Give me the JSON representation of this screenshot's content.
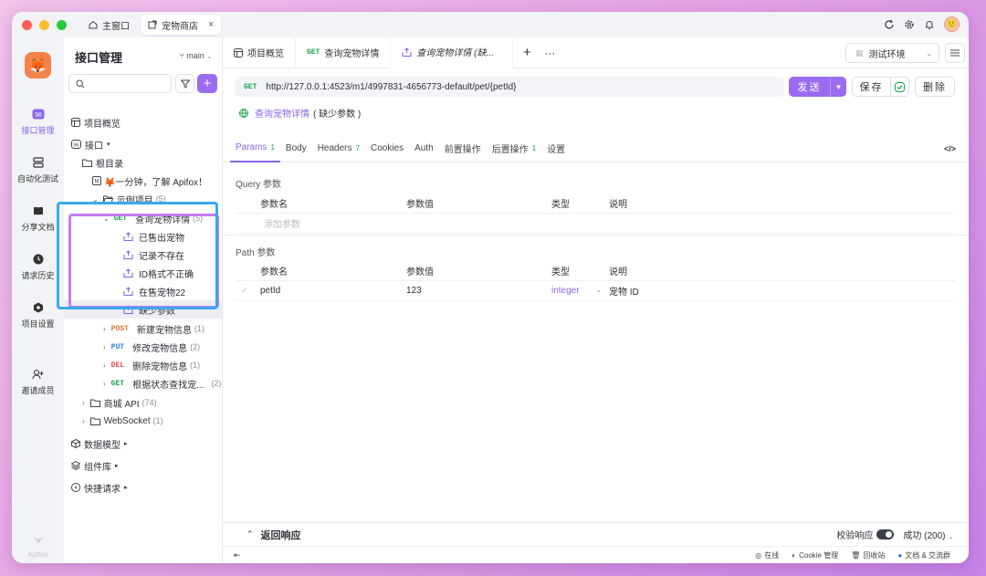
{
  "titlebar": {
    "tabs": [
      {
        "label": "主窗口"
      },
      {
        "label": "宠物商店"
      }
    ]
  },
  "rail": {
    "items": [
      {
        "label": "接口管理",
        "icon": "api-icon"
      },
      {
        "label": "自动化测试",
        "icon": "automation-icon"
      },
      {
        "label": "分享文档",
        "icon": "book-icon"
      },
      {
        "label": "请求历史",
        "icon": "history-icon"
      },
      {
        "label": "项目设置",
        "icon": "settings-icon"
      },
      {
        "label": "邀请成员",
        "icon": "invite-icon"
      }
    ],
    "brand": "Apifox"
  },
  "sidebar": {
    "title": "接口管理",
    "branch": "main",
    "search_placeholder": "",
    "tree": [
      {
        "label": "项目概览"
      },
      {
        "label": "接口"
      },
      {
        "label": "根目录"
      },
      {
        "label": "🦊一分钟，了解 Apifox！"
      },
      {
        "label": "示例项目",
        "count": "(5)"
      },
      {
        "method": "GET",
        "label": "查询宠物详情",
        "count": "(5)"
      },
      {
        "label": "已售出宠物"
      },
      {
        "label": "记录不存在"
      },
      {
        "label": "ID格式不正确"
      },
      {
        "label": "在售宠物22"
      },
      {
        "label": "缺少参数"
      },
      {
        "method": "POST",
        "label": "新建宠物信息",
        "count": "(1)"
      },
      {
        "method": "PUT",
        "label": "修改宠物信息",
        "count": "(2)"
      },
      {
        "method": "DEL",
        "label": "删除宠物信息",
        "count": "(1)"
      },
      {
        "method": "GET",
        "label": "根据状态查找宠...",
        "count": "(2)"
      },
      {
        "label": "商城 API",
        "count": "(74)"
      },
      {
        "label": "WebSocket",
        "count": "(1)"
      },
      {
        "label": "数据模型"
      },
      {
        "label": "组件库"
      },
      {
        "label": "快捷请求"
      }
    ]
  },
  "main": {
    "tabs": [
      {
        "label": "项目概览"
      },
      {
        "method": "GET",
        "label": "查询宠物详情"
      },
      {
        "label": "查询宠物详情 (缺..."
      }
    ],
    "env": "测试环境",
    "request": {
      "method": "GET",
      "url": "http://127.0.0.1:4523/m1/4997831-4656773-default/pet/{petId}",
      "send": "发送",
      "save": "保存",
      "delete": "删除"
    },
    "case_name": "查询宠物详情",
    "case_suffix": "( 缺少参数 )",
    "param_tabs": [
      {
        "label": "Params",
        "badge": "1"
      },
      {
        "label": "Body"
      },
      {
        "label": "Headers",
        "badge": "7"
      },
      {
        "label": "Cookies"
      },
      {
        "label": "Auth"
      },
      {
        "label": "前置操作"
      },
      {
        "label": "后置操作",
        "badge": "1"
      },
      {
        "label": "设置"
      }
    ],
    "query": {
      "title": "Query 参数",
      "columns": [
        "参数名",
        "参数值",
        "类型",
        "说明"
      ],
      "placeholder": "添加参数"
    },
    "path": {
      "title": "Path 参数",
      "columns": [
        "参数名",
        "参数值",
        "类型",
        "说明"
      ],
      "rows": [
        {
          "name": "petId",
          "value": "123",
          "type": "integer",
          "desc": "宠物 ID"
        }
      ]
    },
    "response": {
      "title": "返回响应",
      "validate": "校验响应",
      "status": "成功 (200)"
    },
    "statusbar": {
      "online": "在线",
      "cookie": "Cookie 管理",
      "recycle": "回收站",
      "docs": "文档 & 交流群"
    }
  },
  "colors": {
    "accent": "#9b6cf0",
    "get": "#17a34a",
    "post": "#e8702a",
    "put": "#3478f6",
    "del": "#e5484d",
    "highlight_blue": "#3aa8f0",
    "highlight_purple": "#c57af0"
  }
}
